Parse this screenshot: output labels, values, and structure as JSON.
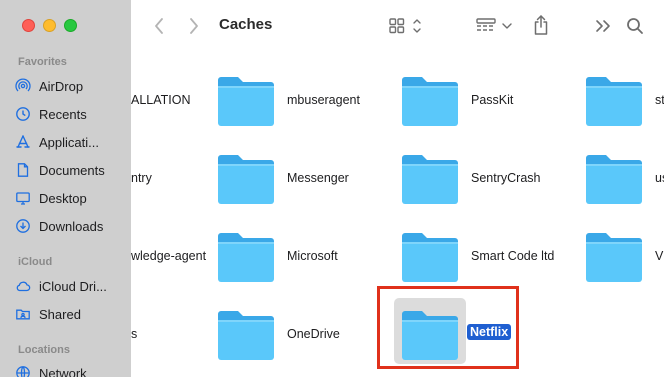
{
  "window": {
    "title": "Caches"
  },
  "sidebar": {
    "favorites_header": "Favorites",
    "favorites": [
      {
        "label": "AirDrop",
        "icon": "airdrop-icon"
      },
      {
        "label": "Recents",
        "icon": "clock-icon"
      },
      {
        "label": "Applicati...",
        "icon": "applications-icon"
      },
      {
        "label": "Documents",
        "icon": "document-icon"
      },
      {
        "label": "Desktop",
        "icon": "desktop-icon"
      },
      {
        "label": "Downloads",
        "icon": "download-icon"
      }
    ],
    "icloud_header": "iCloud",
    "icloud": [
      {
        "label": "iCloud Dri...",
        "icon": "cloud-icon"
      },
      {
        "label": "Shared",
        "icon": "shared-folder-icon"
      }
    ],
    "locations_header": "Locations",
    "locations": [
      {
        "label": "Network",
        "icon": "network-icon"
      }
    ]
  },
  "folders": {
    "col0_cut": [
      "ALLATION",
      "ntry",
      "wledge-agent",
      "s"
    ],
    "col1": [
      "mbuseragent",
      "Messenger",
      "Microsoft",
      "OneDrive"
    ],
    "col2": [
      "PassKit",
      "SentryCrash",
      "Smart Code ltd"
    ],
    "selected": "Netflix",
    "col3_cut": [
      "st",
      "us",
      "V"
    ]
  },
  "colors": {
    "accent": "#1f5fd1",
    "highlight": "#e0311b",
    "folder": "#5ac8fa"
  }
}
